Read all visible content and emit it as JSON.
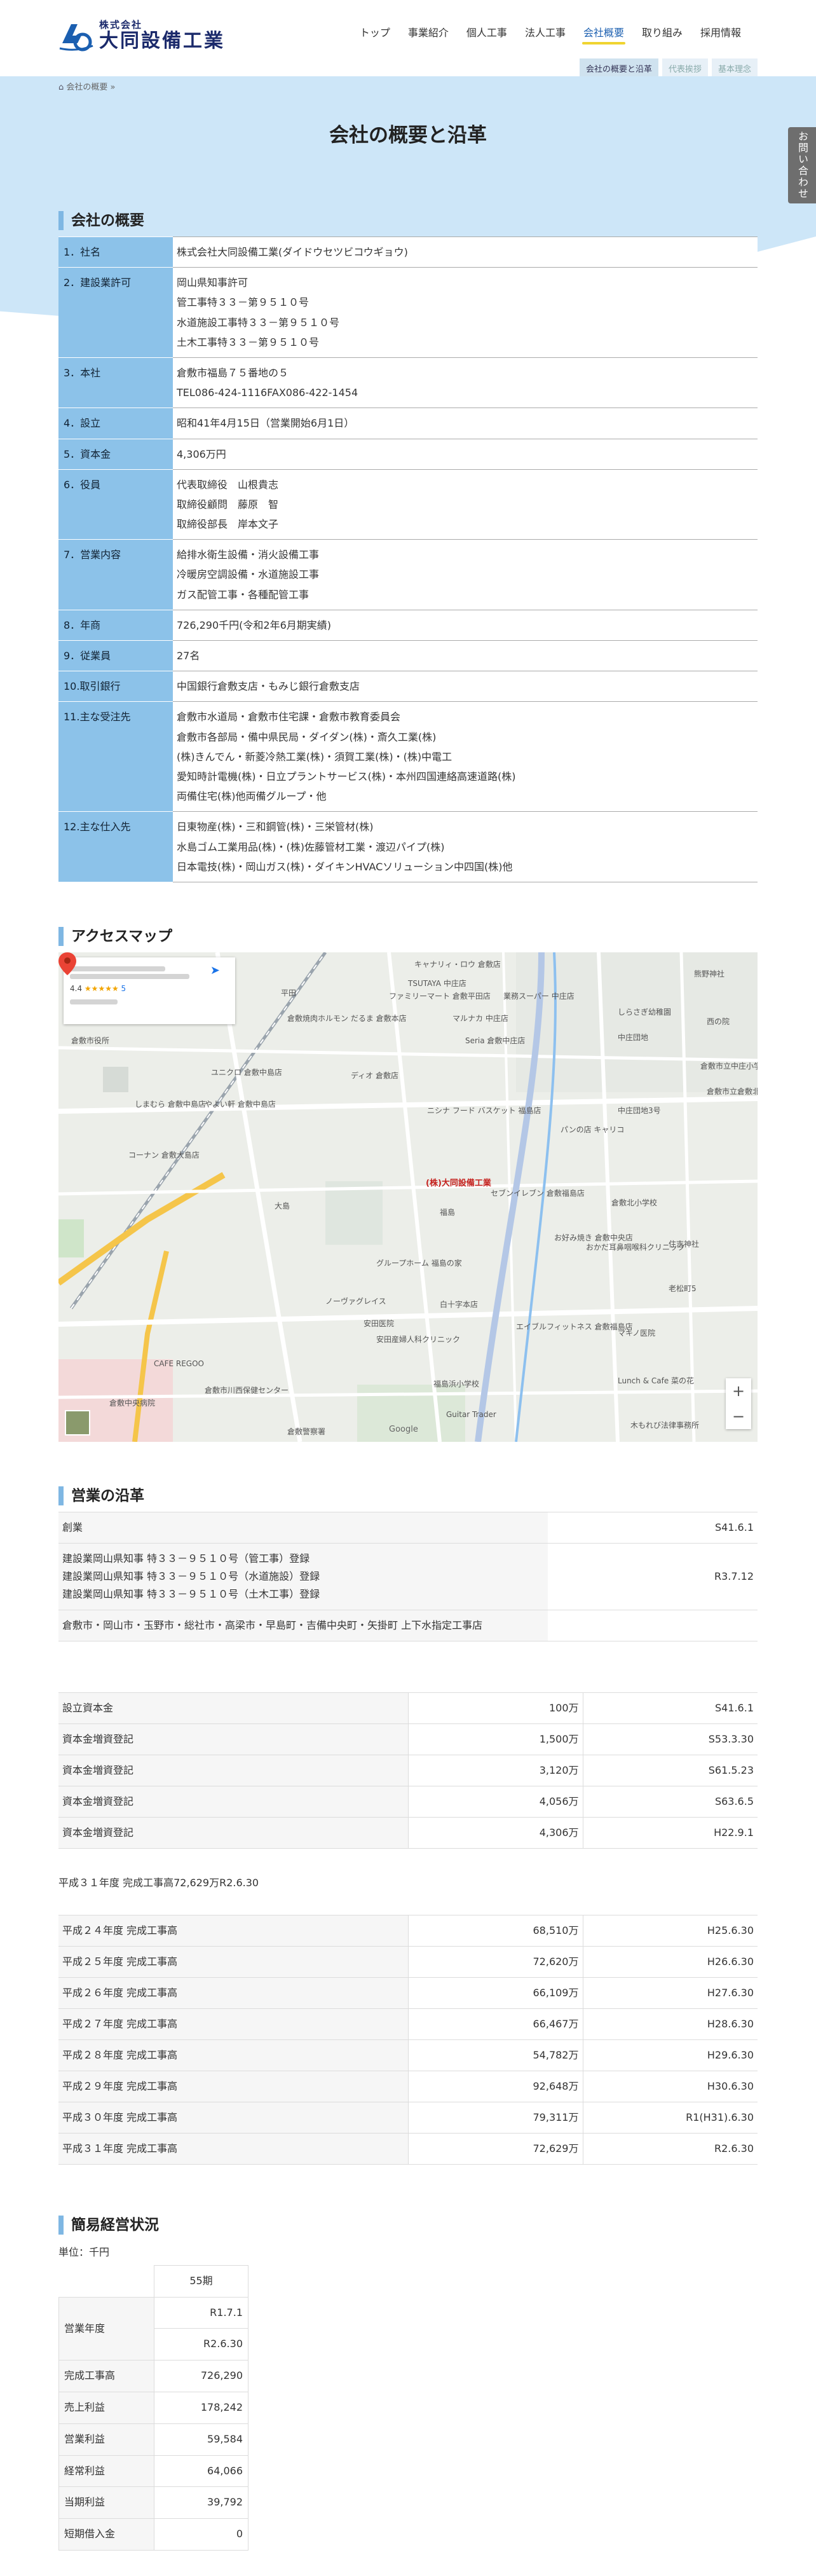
{
  "header": {
    "logo_small": "株式会社",
    "logo_big": "大同設備工業",
    "nav": [
      "トップ",
      "事業紹介",
      "個人工事",
      "法人工事",
      "会社概要",
      "取り組み",
      "採用情報"
    ],
    "subnav": [
      "会社の概要と沿革",
      "代表挨拶",
      "基本理念"
    ]
  },
  "contact_tab": "お問い合わせ",
  "breadcrumb": "会社の概要 »",
  "page_title": "会社の概要と沿革",
  "overview": {
    "heading": "会社の概要",
    "rows": [
      {
        "label": "1．社名",
        "lines": [
          "株式会社大同設備工業(ダイドウセツビコウギョウ)"
        ]
      },
      {
        "label": "2．建設業許可",
        "lines": [
          "岡山県知事許可",
          "管工事特３３－第９５１０号",
          "水道施設工事特３３－第９５１０号",
          "土木工事特３３－第９５１０号"
        ]
      },
      {
        "label": "3．本社",
        "lines": [
          "倉敷市福島７５番地の５",
          "TEL086-424-1116FAX086-422-1454"
        ]
      },
      {
        "label": "4．設立",
        "lines": [
          "昭和41年4月15日（営業開始6月1日）"
        ]
      },
      {
        "label": "5．資本金",
        "lines": [
          "4,306万円"
        ]
      },
      {
        "label": "6．役員",
        "lines": [
          "代表取締役　山根貴志",
          "取締役顧問　藤原　智",
          "取締役部長　岸本文子"
        ]
      },
      {
        "label": "7．営業内容",
        "lines": [
          "給排水衛生設備・消火設備工事",
          "冷暖房空調設備・水道施設工事",
          "ガス配管工事・各種配管工事"
        ]
      },
      {
        "label": "8．年商",
        "lines": [
          "726,290千円(令和2年6月期実績)"
        ]
      },
      {
        "label": "9．従業員",
        "lines": [
          "27名"
        ]
      },
      {
        "label": "10.取引銀行",
        "lines": [
          "中国銀行倉敷支店・もみじ銀行倉敷支店"
        ]
      },
      {
        "label": "11.主な受注先",
        "lines": [
          "倉敷市水道局・倉敷市住宅課・倉敷市教育委員会",
          "倉敷市各部局・備中県民局・ダイダン(株)・斎久工業(株)",
          "(株)きんでん・新菱冷熱工業(株)・須賀工業(株)・(株)中電工",
          "愛知時計電機(株)・日立プラントサービス(株)・本州四国連絡高速道路(株)",
          "両備住宅(株)他両備グループ・他"
        ]
      },
      {
        "label": "12.主な仕入先",
        "lines": [
          "日東物産(株)・三和鋼管(株)・三栄管材(株)",
          "水島ゴム工業用品(株)・(株)佐藤管材工業・渡辺パイプ(株)",
          "日本電技(株)・岡山ガス(株)・ダイキンHVACソリューション中四国(株)他"
        ]
      }
    ]
  },
  "access": {
    "heading": "アクセスマップ",
    "card_rating": "4.4",
    "card_stars": "★★★★★",
    "card_reviews": "5",
    "pin_label": "(株)大同設備工業",
    "google": "Google",
    "zoom_in": "+",
    "zoom_out": "−",
    "labels": [
      "キャナリィ・ロウ 倉敷店",
      "TSUTAYA 中庄店",
      "ファミリーマート 倉敷平田店",
      "業務スーパー 中庄店",
      "熊野神社",
      "しらさぎ幼稚園",
      "西の院",
      "中庄団地",
      "平田",
      "倉敷焼肉ホルモン だるま 倉敷本店",
      "マルナカ 中庄店",
      "Seria 倉敷中庄店",
      "倉敷市役所",
      "ユニクロ 倉敷中島店",
      "ディオ 倉敷店",
      "倉敷市立中庄小学校",
      "中庄団地3号",
      "倉敷市立倉敷北…",
      "やよい軒 倉敷中島店",
      "しまむら 倉敷中島店",
      "ニシナ フード バスケット 福島店",
      "パンの店 キャリコ",
      "コーナン 倉敷大島店",
      "(株)大同設備工業",
      "セブンイレブン 倉敷福島店",
      "倉敷北小学校",
      "大島",
      "福島",
      "お好み焼き 倉敷中央店",
      "おかだ耳鼻咽喉科クリニック",
      "住吉神社",
      "グループホーム 福島の家",
      "ノーヴァグレイス",
      "白十字本店",
      "安田医院",
      "エイブルフィットネス 倉敷福島店",
      "マキノ医院",
      "安田産婦人科クリニック",
      "CAFE REGOO",
      "倉敷中央病院",
      "福島浜小学校",
      "Lunch & Cafe 菜の花",
      "倉敷市川西保健センター",
      "Guitar Trader",
      "木もれび法律事務所",
      "老松町5",
      "倉敷警察署"
    ]
  },
  "history": {
    "heading": "営業の沿革",
    "table1": [
      {
        "lines": [
          "創業"
        ],
        "value": "S41.6.1"
      },
      {
        "lines": [
          "建設業岡山県知事 特３３－９５１０号（管工事）登録",
          "建設業岡山県知事 特３３－９５１０号（水道施設）登録",
          "建設業岡山県知事 特３３－９５１０号（土木工事）登録"
        ],
        "value": "R3.7.12"
      },
      {
        "lines": [
          "倉敷市・岡山市・玉野市・総社市・高梁市・早島町・吉備中央町・矢掛町 上下水指定工事店"
        ],
        "value": ""
      }
    ],
    "table2": [
      {
        "label": "設立資本金",
        "amount": "100万",
        "date": "S41.6.1"
      },
      {
        "label": "資本金増資登記",
        "amount": "1,500万",
        "date": "S53.3.30"
      },
      {
        "label": "資本金増資登記",
        "amount": "3,120万",
        "date": "S61.5.23"
      },
      {
        "label": "資本金増資登記",
        "amount": "4,056万",
        "date": "S63.6.5"
      },
      {
        "label": "資本金増資登記",
        "amount": "4,306万",
        "date": "H22.9.1"
      }
    ],
    "plain_line": "平成３１年度 完成工事高72,629万R2.6.30",
    "table3": [
      {
        "label": "平成２４年度 完成工事高",
        "amount": "68,510万",
        "date": "H25.6.30"
      },
      {
        "label": "平成２５年度 完成工事高",
        "amount": "72,620万",
        "date": "H26.6.30"
      },
      {
        "label": "平成２６年度 完成工事高",
        "amount": "66,109万",
        "date": "H27.6.30"
      },
      {
        "label": "平成２７年度 完成工事高",
        "amount": "66,467万",
        "date": "H28.6.30"
      },
      {
        "label": "平成２８年度 完成工事高",
        "amount": "54,782万",
        "date": "H29.6.30"
      },
      {
        "label": "平成２９年度 完成工事高",
        "amount": "92,648万",
        "date": "H30.6.30"
      },
      {
        "label": "平成３０年度 完成工事高",
        "amount": "79,311万",
        "date": "R1(H31).6.30"
      },
      {
        "label": "平成３１年度 完成工事高",
        "amount": "72,629万",
        "date": "R2.6.30"
      }
    ]
  },
  "management": {
    "heading": "簡易経営状況",
    "unit": "単位：千円",
    "period": "55期",
    "year_label": "営業年度",
    "year_from": "R1.7.1",
    "year_to": "R2.6.30",
    "rows": [
      {
        "label": "完成工事高",
        "value": "726,290"
      },
      {
        "label": "売上利益",
        "value": "178,242"
      },
      {
        "label": "営業利益",
        "value": "59,584"
      },
      {
        "label": "経常利益",
        "value": "64,066"
      },
      {
        "label": "当期利益",
        "value": "39,792"
      },
      {
        "label": "短期借入金",
        "value": "0"
      }
    ]
  }
}
